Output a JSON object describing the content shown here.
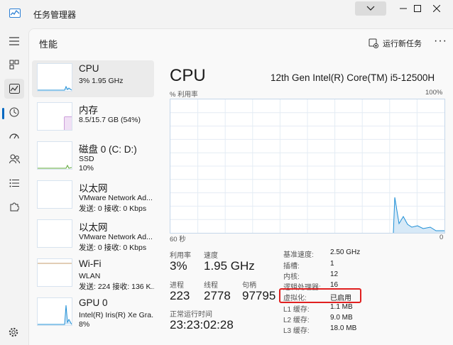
{
  "app": {
    "title": "任务管理器"
  },
  "header": {
    "page_title": "性能",
    "run_new_task": "运行新任务",
    "more": "···"
  },
  "perf_items": [
    {
      "title": "CPU",
      "line1": "3% 1.95 GHz",
      "line2": ""
    },
    {
      "title": "内存",
      "line1": "8.5/15.7 GB (54%)",
      "line2": ""
    },
    {
      "title": "磁盘 0 (C: D:)",
      "line1": "SSD",
      "line2": "10%"
    },
    {
      "title": "以太网",
      "line1": "VMware Network Ad...",
      "line2": "发送: 0 接收: 0 Kbps"
    },
    {
      "title": "以太网",
      "line1": "VMware Network Ad...",
      "line2": "发送: 0 接收: 0 Kbps"
    },
    {
      "title": "Wi-Fi",
      "line1": "WLAN",
      "line2": "发送: 224 接收: 136 K..."
    },
    {
      "title": "GPU 0",
      "line1": "Intel(R) Iris(R) Xe Gra...",
      "line2": "8%"
    }
  ],
  "detail": {
    "title": "CPU",
    "model": "12th Gen Intel(R) Core(TM) i5-12500H",
    "util_label": "% 利用率",
    "pct_max": "100%",
    "axis_left": "60 秒",
    "axis_right": "0",
    "utilization_pct": 3,
    "stats": {
      "util_label": "利用率",
      "util_value": "3%",
      "speed_label": "速度",
      "speed_value": "1.95 GHz",
      "proc_label": "进程",
      "proc_value": "223",
      "thread_label": "线程",
      "thread_value": "2778",
      "handle_label": "句柄",
      "handle_value": "97795",
      "uptime_label": "正常运行时间",
      "uptime_value": "23:23:02:28"
    },
    "specs": [
      {
        "key": "基准速度:",
        "value": "2.50 GHz"
      },
      {
        "key": "插槽:",
        "value": "1"
      },
      {
        "key": "内核:",
        "value": "12"
      },
      {
        "key": "逻辑处理器:",
        "value": "16"
      },
      {
        "key": "虚拟化:",
        "value": "已启用"
      },
      {
        "key": "L1 缓存:",
        "value": "1.1 MB"
      },
      {
        "key": "L2 缓存:",
        "value": "9.0 MB"
      },
      {
        "key": "L3 缓存:",
        "value": "18.0 MB"
      }
    ]
  },
  "colors": {
    "accent": "#0067c0",
    "cpu_line": "#1f8fd6",
    "mem_line": "#9b3fb5",
    "disk_line": "#5fa83a",
    "highlight": "#e02020"
  }
}
